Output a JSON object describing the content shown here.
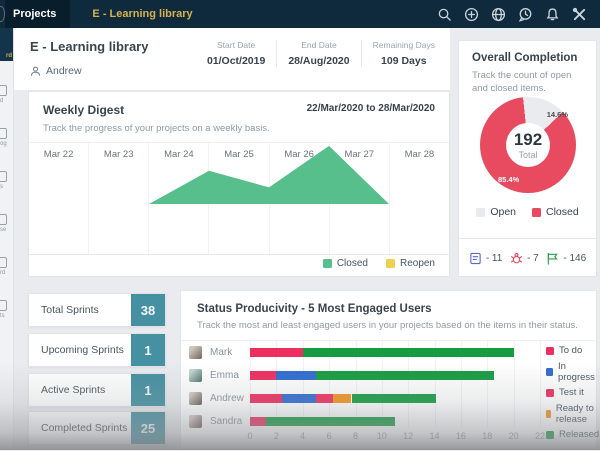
{
  "topbar": {
    "nav": {
      "projects": "Projects",
      "current_project": "E - Learning library"
    },
    "icons": [
      "search",
      "add",
      "explore",
      "recent-activity",
      "notifications",
      "setup"
    ]
  },
  "sidebar": {
    "active_item_label": "rd",
    "item_labels": [
      "d",
      "og",
      "s",
      "se",
      "rd",
      "ts"
    ]
  },
  "header": {
    "project_title": "E - Learning library",
    "owner": "Andrew",
    "dates": [
      {
        "label": "Start Date",
        "value": "01/Oct/2019"
      },
      {
        "label": "End Date",
        "value": "28/Aug/2020"
      },
      {
        "label": "Remaining Days",
        "value": "109 Days"
      }
    ]
  },
  "weekly_digest": {
    "title": "Weekly Digest",
    "subtitle": "Track the progress of your projects on a weekly basis.",
    "date_range": "22/Mar/2020 to 28/Mar/2020",
    "legend": [
      {
        "label": "Closed",
        "color": "#56bf8b"
      },
      {
        "label": "Reopen",
        "color": "#ecd24e"
      }
    ]
  },
  "overall_completion": {
    "title": "Overall Completion",
    "subtitle": "Track the count of open and closed items.",
    "total_value": "192",
    "total_label": "Total",
    "open_pct_label": "14.6%",
    "closed_pct_label": "85.4%",
    "legend": [
      {
        "label": "Open",
        "color": "#e9ebee"
      },
      {
        "label": "Closed",
        "color": "#e84b5f"
      }
    ],
    "counters": [
      {
        "icon": "story-icon",
        "value": "- 11",
        "color": "#5c6bc0"
      },
      {
        "icon": "bug-icon",
        "value": "- 7",
        "color": "#e8495f"
      },
      {
        "icon": "flag-icon",
        "value": "- 146",
        "color": "#2f9e52"
      }
    ]
  },
  "sprint_stats": [
    {
      "label": "Total Sprints",
      "value": "38"
    },
    {
      "label": "Upcoming Sprints",
      "value": "1"
    },
    {
      "label": "Active Sprints",
      "value": "1"
    },
    {
      "label": "Completed Sprints",
      "value": "25"
    }
  ],
  "status_productivity": {
    "title": "Status Producivity - 5 Most Engaged Users",
    "subtitle": "Track the most and least engaged users in your projects based on the items in their status."
  },
  "colors": {
    "topbar_bg": "#0e2a3c",
    "accent_gold": "#d6b24c",
    "stat_teal": "#4590a1",
    "donut_red": "#e84b5f",
    "area_green": "#56bf8b"
  },
  "chart_data": [
    {
      "name": "weekly_digest_area",
      "type": "area",
      "categories": [
        "Mar 22",
        "Mar 23",
        "Mar 24",
        "Mar 25",
        "Mar 26",
        "Mar 27",
        "Mar 28"
      ],
      "series": [
        {
          "name": "Closed",
          "color": "#56bf8b",
          "values": [
            0,
            0,
            0,
            4,
            2,
            7,
            0
          ]
        },
        {
          "name": "Reopen",
          "color": "#ecd24e",
          "values": [
            0,
            0,
            0,
            0,
            0,
            0,
            0
          ]
        }
      ],
      "title": "Weekly Digest",
      "xlabel": "",
      "ylabel": "",
      "grid": "vertical-only",
      "legend_position": "bottom-right",
      "note": "no y-axis shown; values are relative estimates"
    },
    {
      "name": "overall_completion_donut",
      "type": "pie",
      "labels": [
        "Open",
        "Closed"
      ],
      "values": [
        14.6,
        85.4
      ],
      "colors": [
        "#e9ebee",
        "#e84b5f"
      ],
      "center_total": 192,
      "start_angle_deg": -6,
      "legend_position": "bottom"
    },
    {
      "name": "status_productivity_stacked_bar",
      "type": "bar",
      "orientation": "horizontal",
      "stacked": true,
      "categories": [
        "Mark",
        "Emma",
        "Andrew",
        "Sandra"
      ],
      "series": [
        {
          "name": "To do",
          "color": "#ee2e5f",
          "values": [
            4,
            2,
            2.4,
            1.2
          ]
        },
        {
          "name": "In progress",
          "color": "#2f6bd0",
          "values": [
            0,
            3,
            2.6,
            0
          ]
        },
        {
          "name": "Test it",
          "color": "#ee2e5f",
          "values": [
            0,
            0,
            1.3,
            0
          ]
        },
        {
          "name": "Ready to release",
          "color": "#f3941e",
          "values": [
            0,
            0,
            1.4,
            0
          ]
        },
        {
          "name": "Released",
          "color": "#169b41",
          "values": [
            16,
            13.5,
            6.4,
            9.8
          ]
        }
      ],
      "xlim": [
        0,
        22
      ],
      "xticks": [
        0,
        2,
        4,
        6,
        8,
        10,
        12,
        14,
        16,
        18,
        20,
        22
      ],
      "legend_position": "right"
    }
  ]
}
